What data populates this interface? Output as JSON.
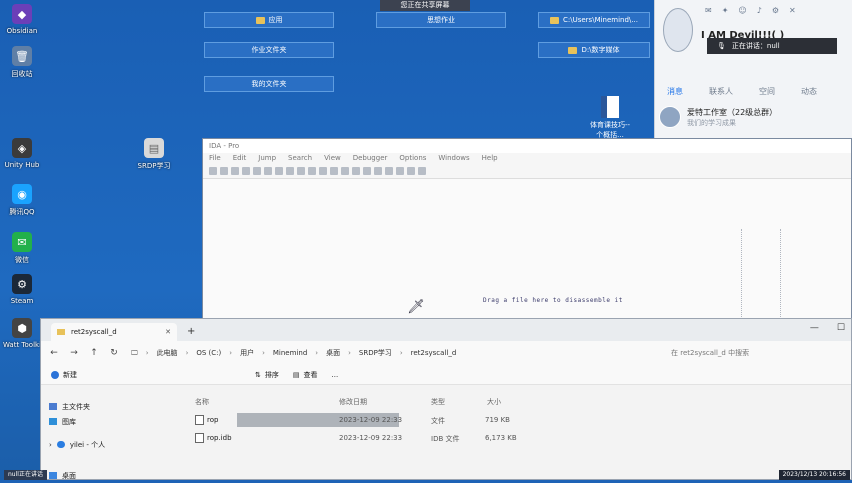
{
  "share_banner": "您正在共享屏幕",
  "desktop_icons": [
    {
      "label": "Obsidian",
      "glyph": "◆",
      "color": "#6b3fb8"
    },
    {
      "label": "回收站",
      "glyph": "🗑",
      "color": "#5f7fa6"
    },
    {
      "label": "Unity Hub",
      "glyph": "◈",
      "color": "#3b3b3b"
    },
    {
      "label": "腾讯QQ",
      "glyph": "◉",
      "color": "#1aa3ff"
    },
    {
      "label": "微信",
      "glyph": "✉",
      "color": "#22b04b"
    },
    {
      "label": "Steam",
      "glyph": "⚙",
      "color": "#1b2838"
    },
    {
      "label": "Watt Toolki",
      "glyph": "⬢",
      "color": "#444"
    },
    {
      "label": "SRDP学习",
      "glyph": "▤",
      "color": "#d9d9d9"
    }
  ],
  "chips": [
    {
      "label": "应用"
    },
    {
      "label": "作业文件夹"
    },
    {
      "label": "我的文件夹"
    },
    {
      "label": "思想作业"
    },
    {
      "label": "C:\\Users\\Minemind\\..."
    },
    {
      "label": "D:\\数字媒体"
    }
  ],
  "word_doc": {
    "label": "体育课技巧--个概括..."
  },
  "chat": {
    "username": "I AM Devil!!!( )",
    "status": "正在讲话：null",
    "tabs": [
      "消息",
      "联系人",
      "空间",
      "动态"
    ],
    "group_name": "爱特工作室（22级总群）",
    "group_sub": "我们的学习成果"
  },
  "ida": {
    "title": "IDA - Pro",
    "menu": [
      "File",
      "Edit",
      "Jump",
      "Search",
      "View",
      "Debugger",
      "Options",
      "Windows",
      "Help"
    ],
    "drop_message": "Drag a file here to disassemble it"
  },
  "explorer": {
    "tab_title": "ret2syscall_d",
    "breadcrumb": [
      "此电脑",
      "OS (C:)",
      "用户",
      "Minemind",
      "桌面",
      "SRDP学习",
      "ret2syscall_d"
    ],
    "search_placeholder": "在 ret2syscall_d 中搜索",
    "commands": [
      "新建",
      "排序",
      "查看",
      "..."
    ],
    "sidebar": [
      "主文件夹",
      "图库",
      "yilei - 个人",
      "桌面"
    ],
    "columns": [
      "名称",
      "修改日期",
      "类型",
      "大小"
    ],
    "files": [
      {
        "name": "rop",
        "modified": "2023-12-09 22:33",
        "type": "文件",
        "size": "719 KB"
      },
      {
        "name": "rop.idb",
        "modified": "2023-12-09 22:33",
        "type": "IDB 文件",
        "size": "6,173 KB"
      }
    ]
  },
  "tray_left": "null正在讲话",
  "clock": "2023/12/13 20:16:56"
}
